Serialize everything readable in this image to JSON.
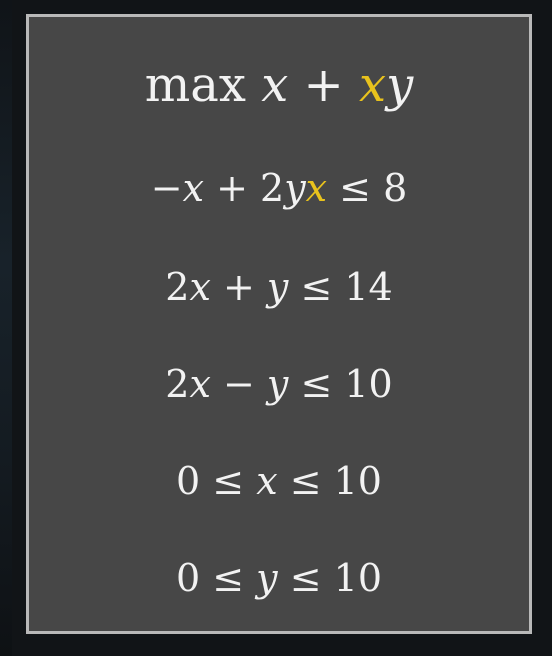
{
  "formula": {
    "objective": [
      {
        "text": "max ",
        "style": "plain"
      },
      {
        "text": "x",
        "style": "var"
      },
      {
        "text": " + ",
        "style": "plain"
      },
      {
        "text": "x",
        "style": "var-highlight"
      },
      {
        "text": "y",
        "style": "var"
      }
    ],
    "constraints": [
      [
        {
          "text": "−",
          "style": "plain"
        },
        {
          "text": "x",
          "style": "var"
        },
        {
          "text": " + 2",
          "style": "plain"
        },
        {
          "text": "y",
          "style": "var"
        },
        {
          "text": "x",
          "style": "var-highlight"
        },
        {
          "text": " ≤ 8",
          "style": "plain"
        }
      ],
      [
        {
          "text": "2",
          "style": "plain"
        },
        {
          "text": "x",
          "style": "var"
        },
        {
          "text": " + ",
          "style": "plain"
        },
        {
          "text": "y",
          "style": "var"
        },
        {
          "text": " ≤ 14",
          "style": "plain"
        }
      ],
      [
        {
          "text": "2",
          "style": "plain"
        },
        {
          "text": "x",
          "style": "var"
        },
        {
          "text": " − ",
          "style": "plain"
        },
        {
          "text": "y",
          "style": "var"
        },
        {
          "text": " ≤ 10",
          "style": "plain"
        }
      ],
      [
        {
          "text": "0 ≤ ",
          "style": "plain"
        },
        {
          "text": "x",
          "style": "var"
        },
        {
          "text": " ≤ 10",
          "style": "plain"
        }
      ],
      [
        {
          "text": "0 ≤ ",
          "style": "plain"
        },
        {
          "text": "y",
          "style": "var"
        },
        {
          "text": " ≤ 10",
          "style": "plain"
        }
      ]
    ]
  },
  "colors": {
    "panel_background": "#474747",
    "panel_border": "#b9b9b9",
    "text": "#f2f2f2",
    "highlight": "#e8c21d",
    "page_background": "#111417"
  }
}
